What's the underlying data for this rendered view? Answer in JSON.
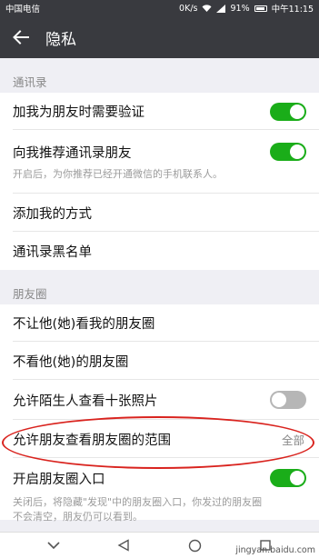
{
  "status_bar": {
    "carrier": "中国电信",
    "indicators": "0K/s",
    "battery_percent": "91%",
    "time": "中午11:15"
  },
  "header": {
    "title": "隐私",
    "back_icon": "arrow-left-icon"
  },
  "contacts_section": {
    "title": "通讯录",
    "items": [
      {
        "label": "加我为朋友时需要验证",
        "toggle": true
      },
      {
        "label": "向我推荐通讯录朋友",
        "desc": "开启后，为你推荐已经开通微信的手机联系人。",
        "toggle": true
      },
      {
        "label": "添加我的方式"
      },
      {
        "label": "通讯录黑名单"
      }
    ]
  },
  "moments_section": {
    "title": "朋友圈",
    "items": [
      {
        "label": "不让他(她)看我的朋友圈"
      },
      {
        "label": "不看他(她)的朋友圈"
      },
      {
        "label": "允许陌生人查看十张照片",
        "toggle": false
      },
      {
        "label": "允许朋友查看朋友圈的范围",
        "value": "全部"
      },
      {
        "label": "开启朋友圈入口",
        "desc": "关闭后，将隐藏\"发现\"中的朋友圈入口，你发过的朋友圈不会清空，朋友仍可以看到。",
        "toggle": true
      }
    ]
  },
  "nav_bar": {
    "icons": [
      "chevron-down-icon",
      "back-triangle-icon",
      "home-circle-icon",
      "recents-square-icon"
    ]
  },
  "watermark": "jingyan.baidu.com",
  "colors": {
    "bar": "#393a3f",
    "toggle_on": "#1aad19",
    "toggle_off": "#b6b6b6",
    "annotation": "#d9231e"
  }
}
